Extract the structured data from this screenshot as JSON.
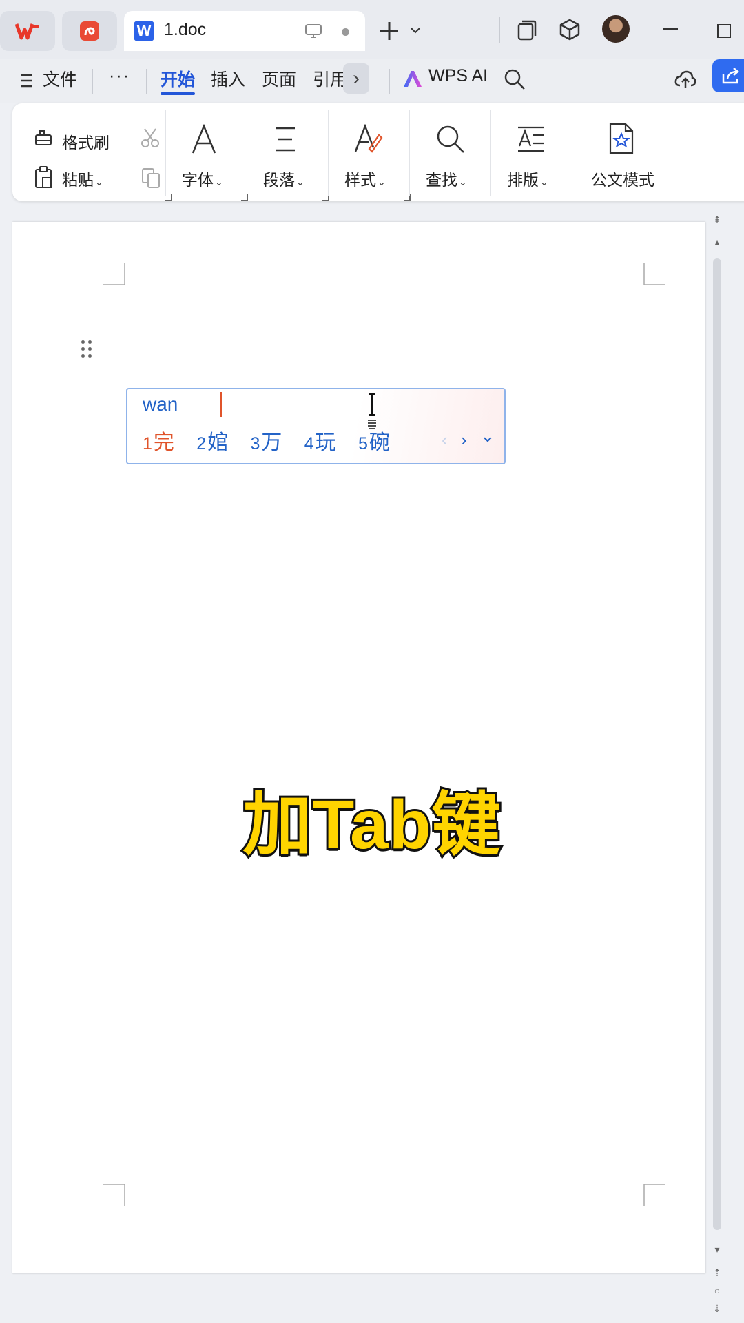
{
  "titlebar": {
    "doc_tab_label": "1.doc",
    "new_tab_symbol": "+",
    "icons": [
      "wps-logo-icon",
      "pdf-app-icon",
      "word-doc-icon",
      "monitor-icon",
      "unsaved-dot-icon",
      "add-tab-icon",
      "chevron-down-icon",
      "window-tile-icon",
      "package-icon",
      "avatar",
      "minimize-icon",
      "maximize-icon"
    ]
  },
  "menubar": {
    "file_label": "文件",
    "more_label": "···",
    "tabs": [
      {
        "label": "开始",
        "active": true
      },
      {
        "label": "插入"
      },
      {
        "label": "页面"
      },
      {
        "label": "引用"
      }
    ],
    "ai_label": "WPS AI",
    "icons": [
      "hamburger-icon",
      "chevron-right-icon",
      "wps-ai-icon",
      "search-icon",
      "cloud-upload-icon",
      "share-icon"
    ]
  },
  "ribbon": {
    "format_painter": "格式刷",
    "paste": "粘贴",
    "font": "字体",
    "paragraph": "段落",
    "styles": "样式",
    "find": "查找",
    "layout": "排版",
    "official_mode": "公文模式",
    "icons": [
      "format-painter-icon",
      "cut-icon",
      "paste-icon",
      "copy-icon",
      "font-icon",
      "paragraph-icon",
      "styles-icon",
      "find-icon",
      "layout-icon",
      "official-doc-icon"
    ]
  },
  "ime": {
    "pinyin": "wan",
    "candidates": [
      {
        "num": "1",
        "text": "完"
      },
      {
        "num": "2",
        "text": "婠"
      },
      {
        "num": "3",
        "text": "万"
      },
      {
        "num": "4",
        "text": "玩"
      },
      {
        "num": "5",
        "text": "碗"
      }
    ],
    "prev_symbol": "‹",
    "next_symbol": "›",
    "expand_symbol": "⌄"
  },
  "caption": "加Tab键",
  "colors": {
    "accent": "#2356d8",
    "ime_text": "#2363c7",
    "ime_highlight": "#e0542b",
    "caption_fill": "#ffd400"
  }
}
